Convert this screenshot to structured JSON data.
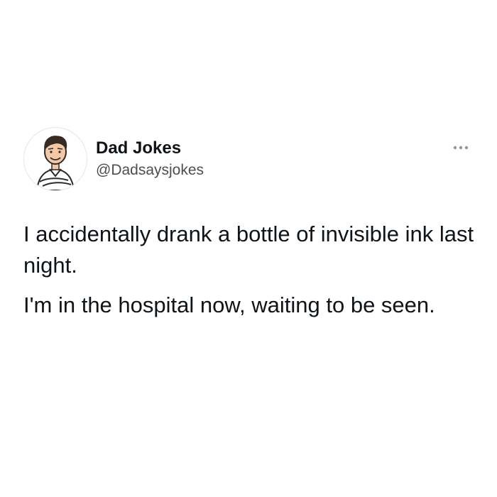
{
  "author": {
    "display_name": "Dad Jokes",
    "handle": "@Dadsaysjokes",
    "avatar_icon": "cartoon-man-avatar-icon"
  },
  "menu": {
    "icon": "more-horizontal-icon"
  },
  "tweet": {
    "paragraphs": [
      "I accidentally drank a bottle of invisible ink last night.",
      "I'm in the hospital now, waiting to be seen."
    ]
  },
  "colors": {
    "text_primary": "#0f1419",
    "text_secondary": "#4a4f54",
    "background": "#ffffff",
    "dots": "#8b98a5"
  }
}
